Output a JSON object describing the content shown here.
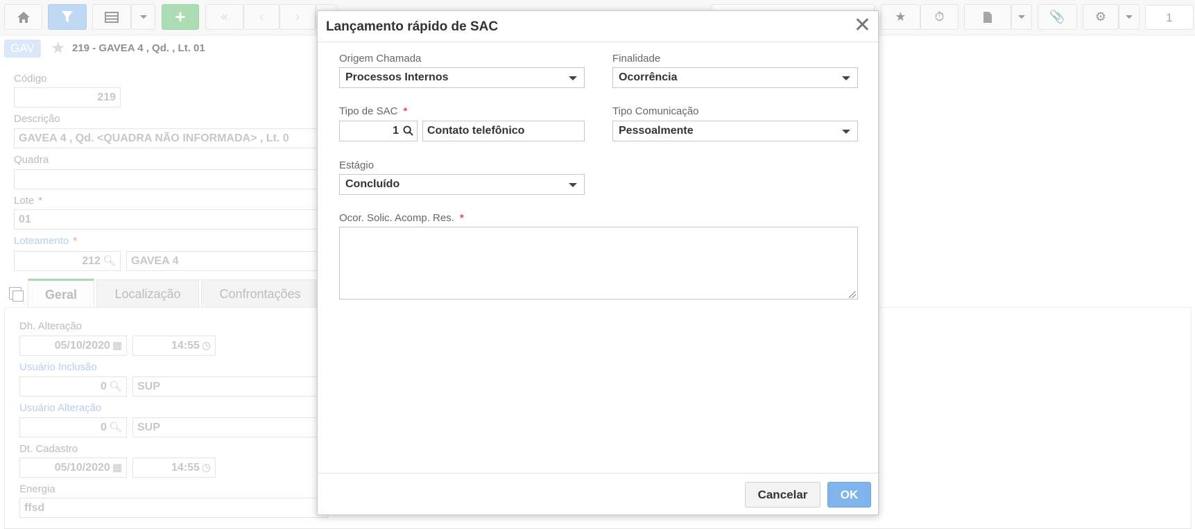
{
  "toolbar": {
    "home_icon": "home-icon",
    "filter_icon": "filter-icon",
    "grid_icon": "grid-icon",
    "add_label": "+",
    "page_number": "1"
  },
  "breadcrumb": {
    "badge": "GAV",
    "title": "219 - GAVEA 4 , Qd. , Lt. 01"
  },
  "form": {
    "codigo_label": "Código",
    "codigo_value": "219",
    "descricao_label": "Descrição",
    "descricao_value": "GAVEA 4 ,  Qd. <QUADRA NÃO INFORMADA> ,  Lt. 0",
    "quadra_label": "Quadra",
    "quadra_value": "",
    "lote_label": "Lote",
    "lote_value": "01",
    "loteamento_label": "Loteamento",
    "loteamento_code": "212",
    "loteamento_name": "GAVEA 4"
  },
  "tabs": [
    {
      "label": "Geral"
    },
    {
      "label": "Localização"
    },
    {
      "label": "Confrontações"
    }
  ],
  "geral": {
    "dh_alteracao_label": "Dh. Alteração",
    "dh_alteracao_date": "05/10/2020",
    "dh_alteracao_time": "14:55",
    "usuario_inclusao_label": "Usuário Inclusão",
    "usuario_inclusao_code": "0",
    "usuario_inclusao_name": "SUP",
    "usuario_alteracao_label": "Usuário Alteração",
    "usuario_alteracao_code": "0",
    "usuario_alteracao_name": "SUP",
    "dt_cadastro_label": "Dt. Cadastro",
    "dt_cadastro_date": "05/10/2020",
    "dt_cadastro_time": "14:55",
    "energia_label": "Energia",
    "energia_value": "ffsd"
  },
  "dialog": {
    "title": "Lançamento rápido de SAC",
    "origem_chamada_label": "Origem Chamada",
    "origem_chamada_value": "Processos Internos",
    "finalidade_label": "Finalidade",
    "finalidade_value": "Ocorrência",
    "tipo_sac_label": "Tipo de SAC",
    "tipo_sac_code": "1",
    "tipo_sac_name": "Contato telefônico",
    "tipo_comunicacao_label": "Tipo Comunicação",
    "tipo_comunicacao_value": "Pessoalmente",
    "estagio_label": "Estágio",
    "estagio_value": "Concluído",
    "ocorrencia_label": "Ocor. Solic. Acomp. Res.",
    "ocorrencia_value": "",
    "cancel_label": "Cancelar",
    "ok_label": "OK",
    "required_mark": "*"
  }
}
